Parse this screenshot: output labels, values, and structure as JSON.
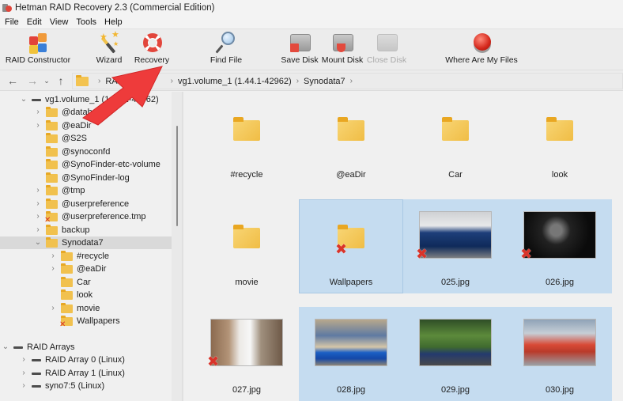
{
  "window": {
    "title": "Hetman RAID Recovery 2.3 (Commercial Edition)"
  },
  "menu": [
    "File",
    "Edit",
    "View",
    "Tools",
    "Help"
  ],
  "toolbar": {
    "raid_constructor": "RAID Constructor",
    "wizard": "Wizard",
    "recovery": "Recovery",
    "find_file": "Find File",
    "save_disk": "Save Disk",
    "mount_disk": "Mount Disk",
    "close_disk": "Close Disk",
    "where_are_my_files": "Where Are My Files"
  },
  "addressbar": {
    "crumbs": [
      "RAID",
      "vg1.volume_1 (1.44.1-42962)",
      "Synodata7"
    ]
  },
  "tree": {
    "root": "vg1.volume_1 (1.44.1-42962)",
    "items": [
      {
        "label": "@database",
        "expandable": true,
        "deleted": false
      },
      {
        "label": "@eaDir",
        "expandable": true,
        "deleted": false
      },
      {
        "label": "@S2S",
        "expandable": false,
        "deleted": false
      },
      {
        "label": "@synoconfd",
        "expandable": false,
        "deleted": false
      },
      {
        "label": "@SynoFinder-etc-volume",
        "expandable": false,
        "deleted": false
      },
      {
        "label": "@SynoFinder-log",
        "expandable": false,
        "deleted": false
      },
      {
        "label": "@tmp",
        "expandable": true,
        "deleted": false
      },
      {
        "label": "@userpreference",
        "expandable": true,
        "deleted": false
      },
      {
        "label": "@userpreference.tmp",
        "expandable": true,
        "deleted": true
      },
      {
        "label": "backup",
        "expandable": true,
        "deleted": false
      },
      {
        "label": "Synodata7",
        "expandable": true,
        "expanded": true,
        "selected": true,
        "deleted": false
      }
    ],
    "synodata7_children": [
      {
        "label": "#recycle",
        "expandable": true,
        "deleted": false
      },
      {
        "label": "@eaDir",
        "expandable": true,
        "deleted": false
      },
      {
        "label": "Car",
        "expandable": false,
        "deleted": false
      },
      {
        "label": "look",
        "expandable": false,
        "deleted": false
      },
      {
        "label": "movie",
        "expandable": true,
        "deleted": false
      },
      {
        "label": "Wallpapers",
        "expandable": false,
        "deleted": true
      }
    ],
    "raid_arrays": {
      "label": "RAID Arrays",
      "items": [
        "RAID Array 0 (Linux)",
        "RAID Array 1 (Linux)",
        "syno7:5 (Linux)"
      ]
    }
  },
  "files": [
    {
      "name": "#recycle",
      "type": "folder",
      "deleted": false,
      "selected": false
    },
    {
      "name": "@eaDir",
      "type": "folder",
      "deleted": false,
      "selected": false
    },
    {
      "name": "Car",
      "type": "folder",
      "deleted": false,
      "selected": false
    },
    {
      "name": "look",
      "type": "folder",
      "deleted": false,
      "selected": false
    },
    {
      "name": "movie",
      "type": "folder",
      "deleted": false,
      "selected": false
    },
    {
      "name": "Wallpapers",
      "type": "folder",
      "deleted": true,
      "selected": true
    },
    {
      "name": "025.jpg",
      "type": "image",
      "deleted": true,
      "selected": true
    },
    {
      "name": "026.jpg",
      "type": "image",
      "deleted": true,
      "selected": true
    },
    {
      "name": "027.jpg",
      "type": "image",
      "deleted": true,
      "selected": false
    },
    {
      "name": "028.jpg",
      "type": "image",
      "deleted": false,
      "selected": true
    },
    {
      "name": "029.jpg",
      "type": "image",
      "deleted": false,
      "selected": true
    },
    {
      "name": "030.jpg",
      "type": "image",
      "deleted": false,
      "selected": true
    }
  ],
  "colors": {
    "selection": "#c5dcf0",
    "folder": "#f1c14e",
    "deleted_mark": "#d9342a",
    "annotation_arrow": "#ee3b3b"
  }
}
